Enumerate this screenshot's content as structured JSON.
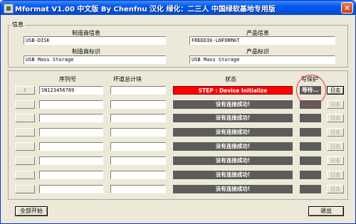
{
  "window": {
    "title": "Mformat V1.00 中文版 By Chenfnu 汉化   绿化：二三人   中国绿软基地专用版",
    "close_glyph": "✕"
  },
  "info": {
    "group_label": "信息",
    "manufacturer_info_label": "制造商信息",
    "manufacturer_info_value": "USB-DISK",
    "manufacturer_id_label": "制造商标识",
    "manufacturer_id_value": "USB Mass Storage",
    "product_info_label": "产品信息",
    "product_info_value": "FREEDIK-LNFORMAT",
    "product_id_label": "产品标识",
    "product_id_value": "USB Mass Storage"
  },
  "table": {
    "headers": {
      "serial": "序列号",
      "bad_blocks": "坏道总计块",
      "status": "状态",
      "write_protect": "写保护"
    },
    "rows": [
      {
        "port": "I",
        "serial": "SN123456789",
        "bad_blocks": "",
        "status": "STEP : Device Initialize",
        "active": true,
        "write_protect": "等待...",
        "log": "日志"
      },
      {
        "port": "",
        "serial": "",
        "bad_blocks": "",
        "status": "没有连接成功!",
        "active": false,
        "write_protect": "",
        "log": "日志"
      },
      {
        "port": "",
        "serial": "",
        "bad_blocks": "",
        "status": "没有连接成功!",
        "active": false,
        "write_protect": "",
        "log": "日志"
      },
      {
        "port": "",
        "serial": "",
        "bad_blocks": "",
        "status": "没有连接成功!",
        "active": false,
        "write_protect": "",
        "log": "日志"
      },
      {
        "port": "",
        "serial": "",
        "bad_blocks": "",
        "status": "没有连接成功!",
        "active": false,
        "write_protect": "",
        "log": "日志"
      },
      {
        "port": "",
        "serial": "",
        "bad_blocks": "",
        "status": "没有连接成功!",
        "active": false,
        "write_protect": "",
        "log": "日志"
      },
      {
        "port": "",
        "serial": "",
        "bad_blocks": "",
        "status": "没有连接成功!",
        "active": false,
        "write_protect": "",
        "log": "日志"
      },
      {
        "port": "",
        "serial": "",
        "bad_blocks": "",
        "status": "没有连接成功!",
        "active": false,
        "write_protect": "",
        "log": "日志"
      }
    ]
  },
  "footer": {
    "start_all": "全部开始",
    "exit": "退出"
  },
  "colors": {
    "active_status": "#ff0000",
    "inactive_status": "#5c5c5c",
    "highlight_circle": "#e23232"
  }
}
